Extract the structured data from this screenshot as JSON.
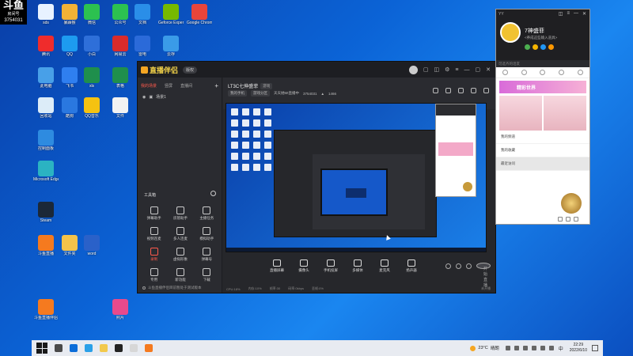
{
  "room_overlay": {
    "logo": "斗鱼",
    "label": "房间号",
    "room_id": "3754031"
  },
  "desktop_icons_left": [
    {
      "label": "sds",
      "color": "#e8f2ff"
    },
    {
      "label": "腾讯",
      "color": "#ef2c2c"
    },
    {
      "label": "此电脑",
      "color": "#48a0e8"
    },
    {
      "label": "回收站",
      "color": "#dcecf8"
    },
    {
      "label": "控制面板",
      "color": "#2e8be0"
    },
    {
      "label": "Microsoft Edge",
      "color": "#2bb3c2"
    },
    {
      "label": "Steam",
      "color": "#1b2838"
    },
    {
      "label": "斗鱼直播",
      "color": "#f57a1f"
    },
    {
      "label": "斗鱼直播伴侣",
      "color": "#f57a1f"
    }
  ],
  "desktop_icons": [
    {
      "label": "暴躁猴",
      "color": "#f2b236"
    },
    {
      "label": "微信",
      "color": "#2cc150"
    },
    {
      "label": "公众号",
      "color": "#2cc150"
    },
    {
      "label": "文档",
      "color": "#2a8ee8"
    },
    {
      "label": "Geforce Experience",
      "color": "#76b900"
    },
    {
      "label": "Google Chrome",
      "color": "#e9453a"
    },
    {
      "label": "QQ",
      "color": "#1d9bf0"
    },
    {
      "label": "小白",
      "color": "#2e6fd9"
    },
    {
      "label": "网易云",
      "color": "#d92b2b"
    },
    {
      "label": "雷电",
      "color": "#2b6ad9"
    },
    {
      "label": "云存",
      "color": "#3a9be8"
    },
    {
      "label": "飞书",
      "color": "#2f7ff0"
    },
    {
      "label": "xls",
      "color": "#1f8f4c"
    },
    {
      "label": "表格",
      "color": "#1f8f4c"
    },
    {
      "label": "酷狗",
      "color": "#2a78e0"
    },
    {
      "label": "QQ音乐",
      "color": "#f5c211"
    },
    {
      "label": "文件",
      "color": "#f2f2f2"
    },
    {
      "label": "文件夹",
      "color": "#f4c34a"
    },
    {
      "label": "word",
      "color": "#2a61c9"
    },
    {
      "label": "照片",
      "color": "#e84a8c"
    }
  ],
  "app": {
    "name": "直播伴侣",
    "version": "版权",
    "side_tabs": [
      "我的场景",
      "竖屏",
      "直播间"
    ],
    "scene": "场景1",
    "tools_title": "工具箱",
    "tools": [
      "弹幕助手",
      "房管助手",
      "主播任务",
      "视频连麦",
      "多人连麦",
      "模拟助手",
      "录制",
      "虚拟形象",
      "弹幕号",
      "专用",
      "新功能",
      "下载"
    ],
    "footer_note": "斗鱼直播伴侣目前暂处于测试版本",
    "room_title": "LT3C七伸盛菲",
    "room_title_tag": "游戏",
    "room_chips": [
      "我的手机",
      "游戏分区"
    ],
    "room_line": "天天她MI直播中",
    "room_id": "3754031",
    "hot_value": "1466",
    "bottom_tools": [
      "直播屏幕",
      "摄像头",
      "手机投屏",
      "多媒体",
      "麦克风",
      "扬声器"
    ],
    "start_label": "开始直播",
    "status": [
      "CPU:18%",
      "内存:10%",
      "帧率:30",
      "码率:0kbps",
      "丢帧:0%"
    ],
    "status_right": "未开播"
  },
  "chat": {
    "app": "YY",
    "name": "7神盛菲",
    "signature": "<养成这些输入道具>",
    "search": "可选齐的话友",
    "banner": "精彩世界",
    "list": [
      "我的频道",
      "我的收藏",
      "最近访问"
    ]
  },
  "taskbar": {
    "weather_temp": "23°C",
    "weather_text": "晴朗",
    "lang": "中",
    "time": "22:29",
    "date": "2022/6/10",
    "pinned_colors": [
      "#4a4a4a",
      "#0b6dd9",
      "#2aa0e8",
      "#f2c94c",
      "#222",
      "#d7d7d7",
      "#f57a1f"
    ]
  }
}
